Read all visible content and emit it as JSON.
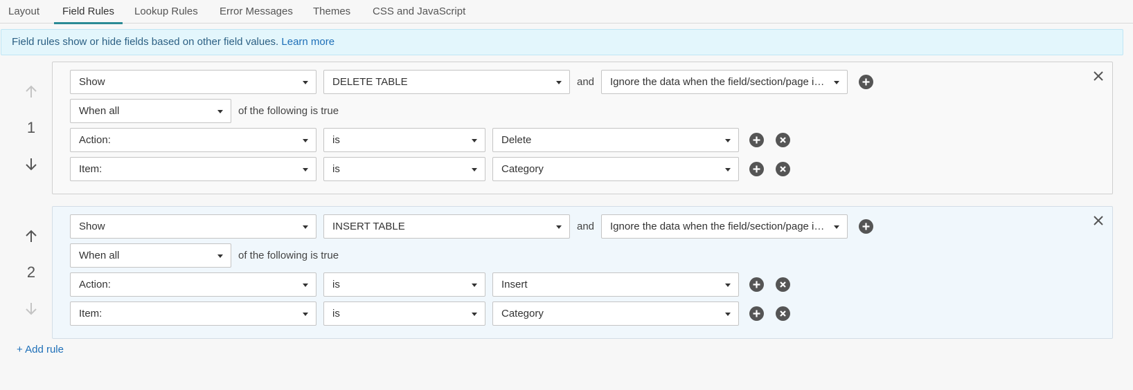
{
  "tabs": [
    {
      "label": "Layout"
    },
    {
      "label": "Field Rules"
    },
    {
      "label": "Lookup Rules"
    },
    {
      "label": "Error Messages"
    },
    {
      "label": "Themes"
    },
    {
      "label": "CSS and JavaScript"
    }
  ],
  "active_tab": "Field Rules",
  "info": {
    "text": "Field rules show or hide fields based on other field values.",
    "link": "Learn more"
  },
  "rules": [
    {
      "number": "1",
      "action": "Show",
      "target": "DELETE TABLE",
      "and_label": "and",
      "data_option": "Ignore the data when the field/section/page is ...",
      "match": "When all",
      "match_suffix": "of the following is true",
      "conditions": [
        {
          "field": "Action:",
          "operator": "is",
          "value": "Delete"
        },
        {
          "field": "Item:",
          "operator": "is",
          "value": "Category"
        }
      ]
    },
    {
      "number": "2",
      "action": "Show",
      "target": "INSERT TABLE",
      "and_label": "and",
      "data_option": "Ignore the data when the field/section/page is ...",
      "match": "When all",
      "match_suffix": "of the following is true",
      "conditions": [
        {
          "field": "Action:",
          "operator": "is",
          "value": "Insert"
        },
        {
          "field": "Item:",
          "operator": "is",
          "value": "Category"
        }
      ]
    }
  ],
  "add_rule_label": "+ Add rule",
  "colors": {
    "accent": "#2a8a95",
    "link": "#1e6fb8",
    "info_bg": "#e3f6fc",
    "rule2_bg": "#f0f7fc"
  }
}
